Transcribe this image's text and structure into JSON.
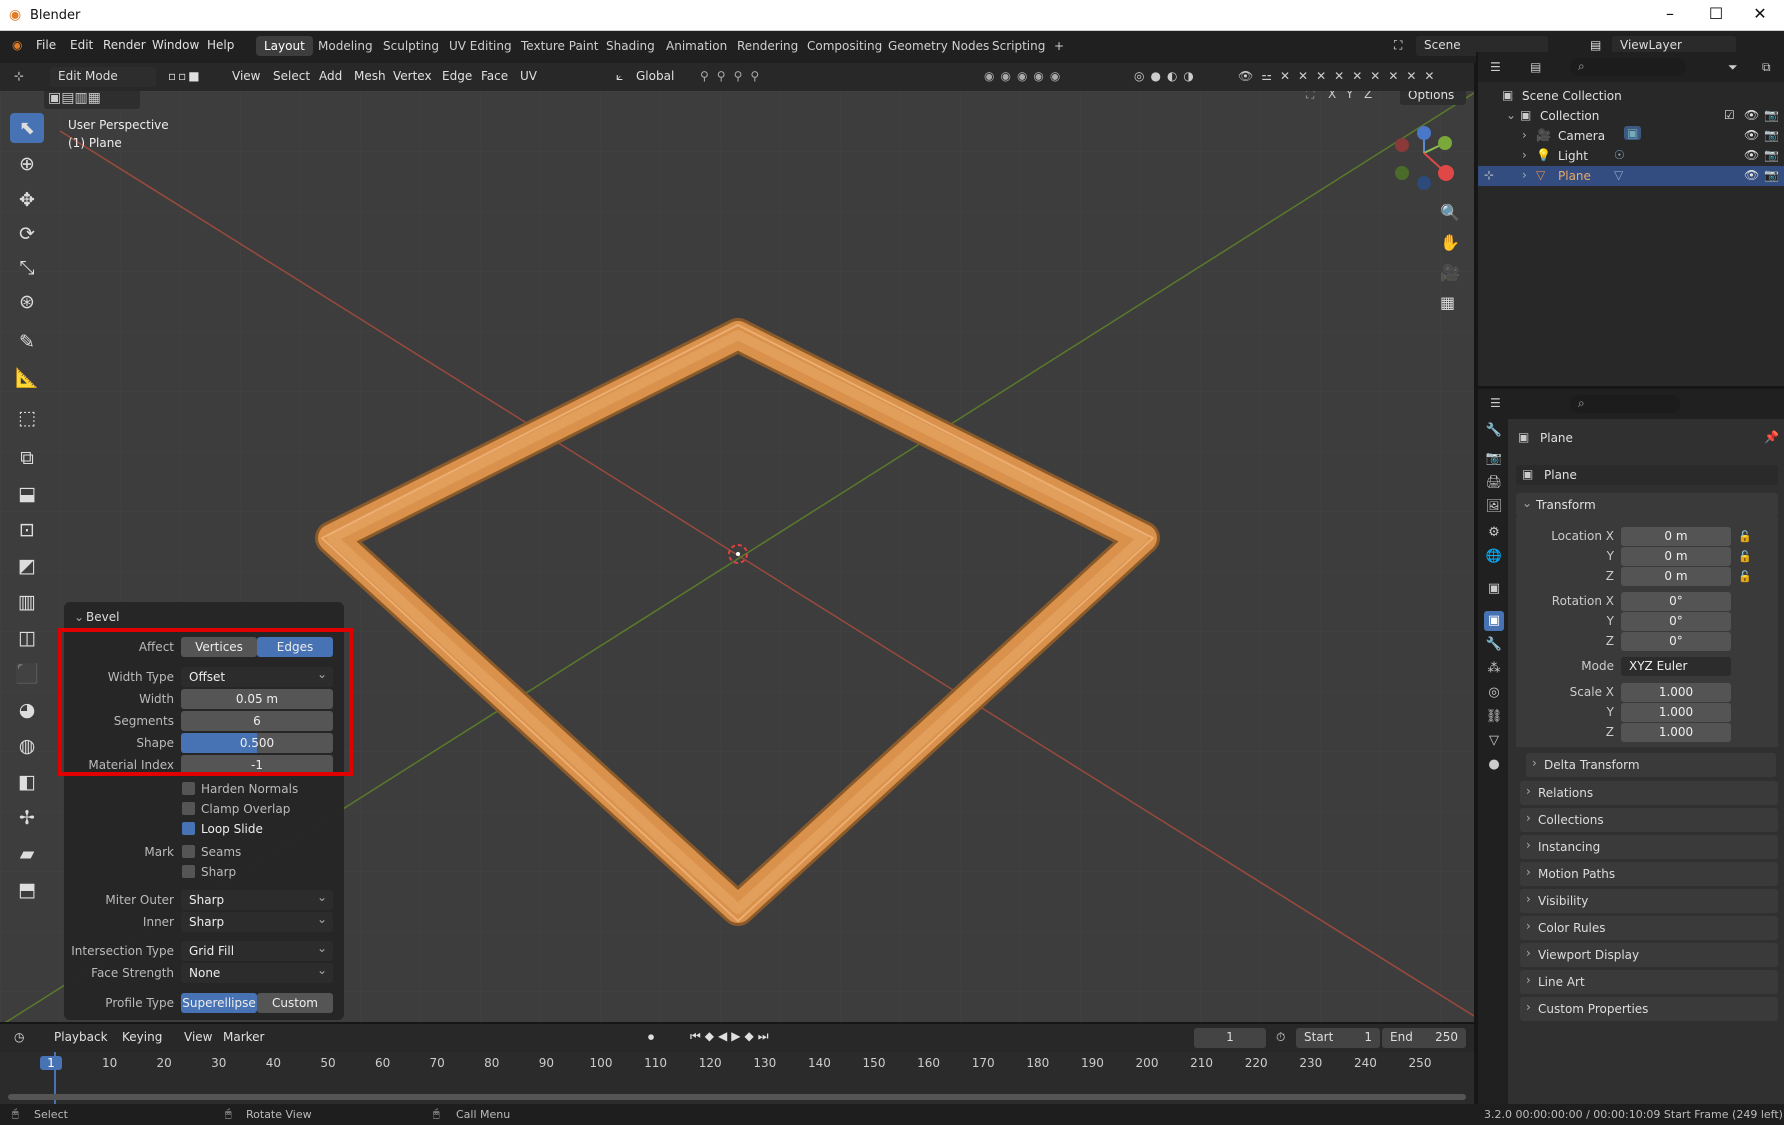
{
  "window": {
    "title": "Blender"
  },
  "menus": [
    "File",
    "Edit",
    "Render",
    "Window",
    "Help"
  ],
  "workspaces": [
    "Layout",
    "Modeling",
    "Sculpting",
    "UV Editing",
    "Texture Paint",
    "Shading",
    "Animation",
    "Rendering",
    "Compositing",
    "Geometry Nodes",
    "Scripting",
    "+"
  ],
  "scene": {
    "label": "Scene",
    "viewlayer": "ViewLayer"
  },
  "header": {
    "mode": "Edit Mode",
    "menus": [
      "View",
      "Select",
      "Add",
      "Mesh",
      "Vertex",
      "Edge",
      "Face",
      "UV"
    ],
    "orientation": "Global",
    "options": "Options",
    "axes": [
      "X",
      "Y",
      "Z"
    ]
  },
  "viewport": {
    "perspective": "User Perspective",
    "object": "(1) Plane"
  },
  "outliner": {
    "root": "Scene Collection",
    "collection": "Collection",
    "items": [
      "Camera",
      "Light",
      "Plane"
    ]
  },
  "properties": {
    "object_name": "Plane",
    "data_name": "Plane",
    "transform": "Transform",
    "location_label": "Location X",
    "rotation_label": "Rotation X",
    "scale_label": "Scale X",
    "mode_label": "Mode",
    "y": "Y",
    "z": "Z",
    "location": [
      "0 m",
      "0 m",
      "0 m"
    ],
    "rotation": [
      "0°",
      "0°",
      "0°"
    ],
    "mode": "XYZ Euler",
    "scale": [
      "1.000",
      "1.000",
      "1.000"
    ],
    "delta": "Delta Transform",
    "sections": [
      "Relations",
      "Collections",
      "Instancing",
      "Motion Paths",
      "Visibility",
      "Color Rules",
      "Viewport Display",
      "Line Art",
      "Custom Properties"
    ]
  },
  "bevel": {
    "title": "Bevel",
    "affect_label": "Affect",
    "affect": [
      "Vertices",
      "Edges"
    ],
    "width_type_label": "Width Type",
    "width_type": "Offset",
    "width_label": "Width",
    "width": "0.05 m",
    "segments_label": "Segments",
    "segments": "6",
    "shape_label": "Shape",
    "shape": "0.500",
    "shape_fraction": 0.5,
    "material_label": "Material Index",
    "material": "-1",
    "harden": "Harden Normals",
    "clamp": "Clamp Overlap",
    "loop_slide": "Loop Slide",
    "mark_label": "Mark",
    "seams": "Seams",
    "sharp": "Sharp",
    "miter_outer_label": "Miter Outer",
    "miter_outer": "Sharp",
    "inner_label": "Inner",
    "inner": "Sharp",
    "intersection_label": "Intersection Type",
    "intersection": "Grid Fill",
    "face_strength_label": "Face Strength",
    "face_strength": "None",
    "profile_label": "Profile Type",
    "profile": [
      "Superellipse",
      "Custom"
    ]
  },
  "timeline": {
    "menus": [
      "Playback",
      "Keying",
      "View",
      "Marker"
    ],
    "current": "1",
    "start_label": "Start",
    "start": "1",
    "end_label": "End",
    "end": "250",
    "ticks": [
      "1",
      "10",
      "20",
      "30",
      "40",
      "50",
      "60",
      "70",
      "80",
      "90",
      "100",
      "110",
      "120",
      "130",
      "140",
      "150",
      "160",
      "170",
      "180",
      "190",
      "200",
      "210",
      "220",
      "230",
      "240",
      "250"
    ]
  },
  "status": {
    "select": "Select",
    "rotate": "Rotate View",
    "call": "Call Menu",
    "right": "3.2.0  00:00:00:00 / 00:00:10:09  Start Frame (249 left)"
  },
  "colors": {
    "accent": "#4772b3",
    "mesh": "#d9914c",
    "selected_row": "#334d80",
    "highlight": "#e00000"
  }
}
